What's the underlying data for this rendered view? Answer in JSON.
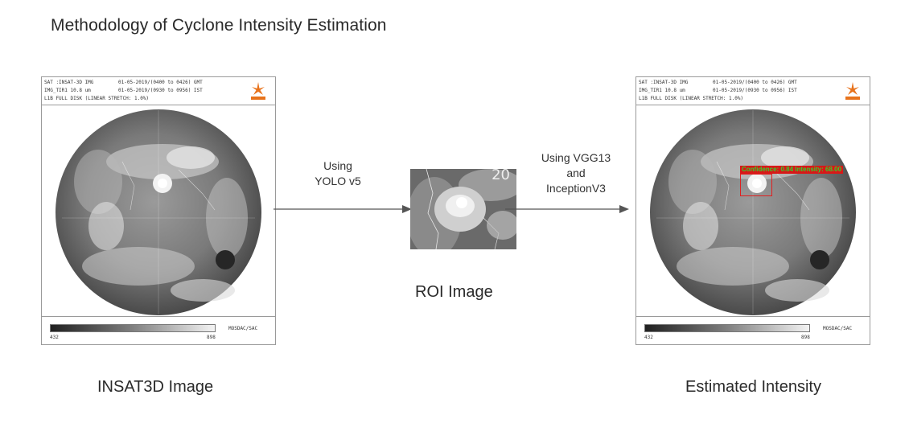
{
  "title": "Methodology of Cyclone Intensity Estimation",
  "panels": {
    "header_line1": "SAT :INSAT-3D IMG",
    "header_line1_right": "01-05-2019/(0400 to 0426) GMT",
    "header_line2": "IMG_TIR1 10.8 um",
    "header_line2_right": "01-05-2019/(0930 to 0956) IST",
    "header_line3": "L1B FULL DISK (LINEAR STRETCH: 1.0%)",
    "colorbar_min": "432",
    "colorbar_max": "898",
    "footer_credit": "MOSDAC/SAC",
    "logo_text": "इसरो isro"
  },
  "captions": {
    "insat": "INSAT3D Image",
    "roi": "ROI Image",
    "estimated": "Estimated Intensity"
  },
  "steps": {
    "step1_line1": "Using",
    "step1_line2": "YOLO v5",
    "step2_line1": "Using VGG13",
    "step2_line2": "and",
    "step2_line3": "InceptionV3"
  },
  "roi_overlay_text": "20",
  "detection": {
    "label": "Confidence: 0.84  Intensity: 68.00"
  },
  "colors": {
    "arrow": "#555555",
    "box": "#e02020",
    "label_bg": "#d81818",
    "label_text": "#2fd22f"
  }
}
